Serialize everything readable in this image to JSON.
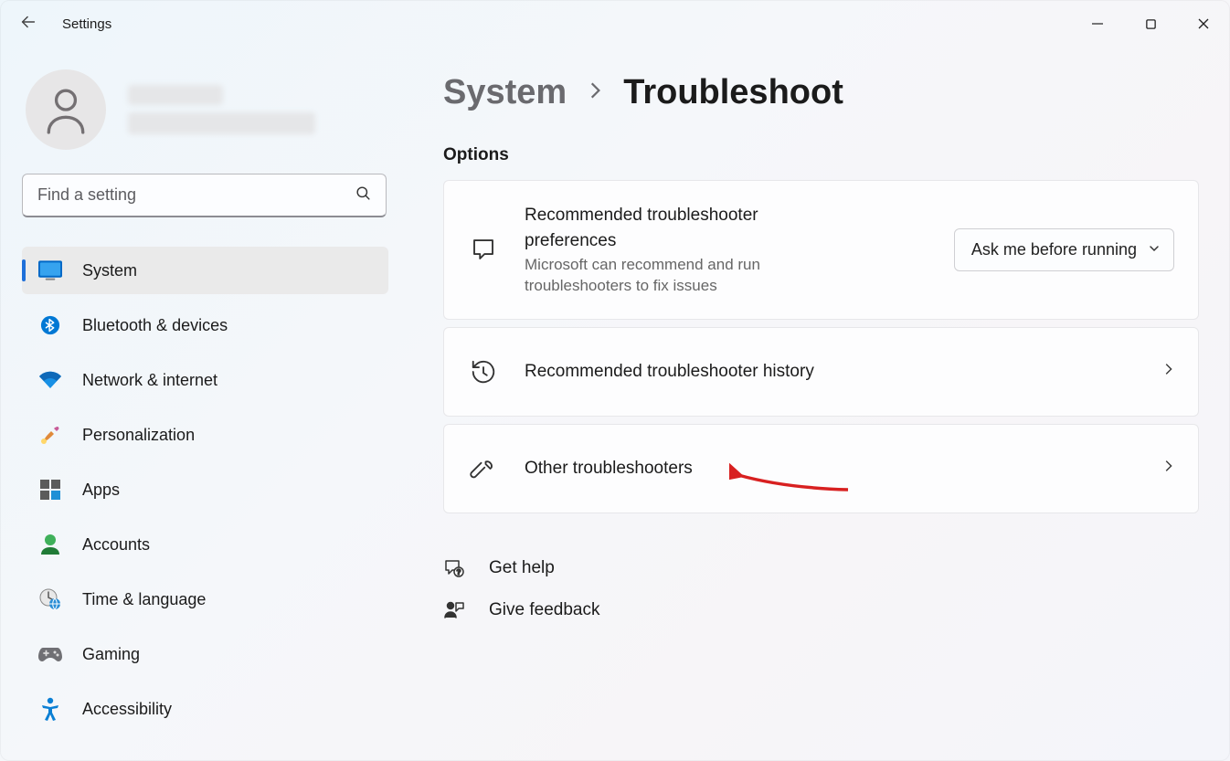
{
  "titlebar": {
    "app_title": "Settings"
  },
  "search": {
    "placeholder": "Find a setting"
  },
  "sidebar": {
    "items": [
      {
        "label": "System"
      },
      {
        "label": "Bluetooth & devices"
      },
      {
        "label": "Network & internet"
      },
      {
        "label": "Personalization"
      },
      {
        "label": "Apps"
      },
      {
        "label": "Accounts"
      },
      {
        "label": "Time & language"
      },
      {
        "label": "Gaming"
      },
      {
        "label": "Accessibility"
      }
    ]
  },
  "breadcrumb": {
    "root": "System",
    "current": "Troubleshoot"
  },
  "section": {
    "options_title": "Options"
  },
  "cards": {
    "preferences": {
      "title": "Recommended troubleshooter preferences",
      "sub": "Microsoft can recommend and run troubleshooters to fix issues",
      "dropdown_value": "Ask me before running"
    },
    "history": {
      "title": "Recommended troubleshooter history"
    },
    "other": {
      "title": "Other troubleshooters"
    }
  },
  "links": {
    "help": "Get help",
    "feedback": "Give feedback"
  }
}
